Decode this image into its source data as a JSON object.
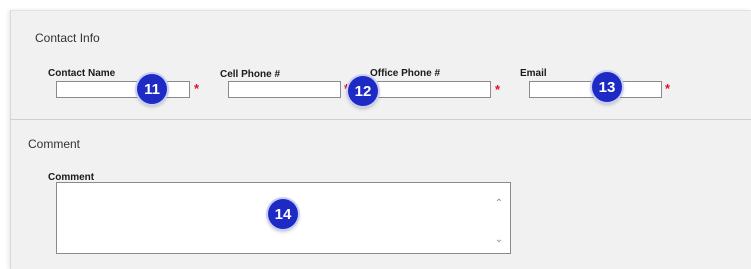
{
  "contact_section": {
    "title": "Contact Info",
    "fields": {
      "contact_name": {
        "label": "Contact Name",
        "value": "",
        "required_marker": "*",
        "badge": "11"
      },
      "cell_phone": {
        "label": "Cell Phone #",
        "value": "",
        "required_marker": "*",
        "badge": "12"
      },
      "office_phone": {
        "label": "Office Phone #",
        "value": "",
        "required_marker": "*"
      },
      "email": {
        "label": "Email",
        "value": "",
        "required_marker": "*",
        "badge": "13"
      }
    }
  },
  "comment_section": {
    "title": "Comment",
    "field": {
      "label": "Comment",
      "value": "",
      "badge": "14"
    }
  },
  "colors": {
    "badge": "#1d2bc4",
    "required": "#e0141e",
    "panel": "#f1f1f1"
  }
}
